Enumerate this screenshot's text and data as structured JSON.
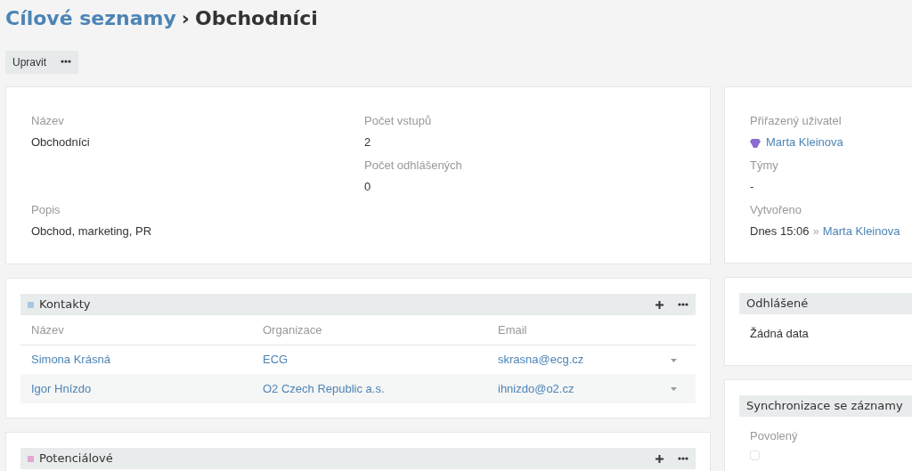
{
  "breadcrumb": {
    "parent": "Cílové seznamy",
    "separator": "›",
    "current": "Obchodníci"
  },
  "actions": [
    {
      "label": "Upravit"
    }
  ],
  "overview": {
    "rows": [
      {
        "cells": [
          {
            "label": "Název",
            "value": "Obchodníci"
          },
          {
            "label": "Počet vstupů",
            "value": "2"
          }
        ]
      },
      {
        "cells": [
          null,
          {
            "label": "Počet odhlášených",
            "value": "0"
          }
        ]
      },
      {
        "cells": [
          {
            "label": "Popis",
            "value": "Obchod, marketing, PR"
          }
        ]
      }
    ]
  },
  "side": {
    "assigned_user": {
      "label": "Přiřazený uživatel",
      "value": "Marta Kleinova"
    },
    "teams": {
      "label": "Týmy",
      "value": "-"
    },
    "created": {
      "label": "Vytvořeno",
      "time": "Dnes 15:06",
      "separator": "»",
      "user": "Marta Kleinova"
    }
  },
  "panels": [
    {
      "title": "Kontakty",
      "color": "#a8c8e4",
      "columns": [
        "Název",
        "Organizace",
        "Email"
      ],
      "rows": [
        {
          "cells": [
            "Simona Krásná",
            "ECG",
            "skrasna@ecg.cz"
          ]
        },
        {
          "cells": [
            "Igor Hnízdo",
            "O2 Czech Republic a.s.",
            "ihnizdo@o2.cz"
          ]
        }
      ]
    },
    {
      "title": "Potenciálové",
      "color": "#e0a8d0"
    }
  ],
  "side_panels": [
    {
      "title": "Odhlášené",
      "kind": "empty",
      "text": "Žádná data"
    },
    {
      "title": "Synchronizace se záznamy",
      "kind": "checkbox",
      "label": "Povolený",
      "checked": false
    }
  ]
}
